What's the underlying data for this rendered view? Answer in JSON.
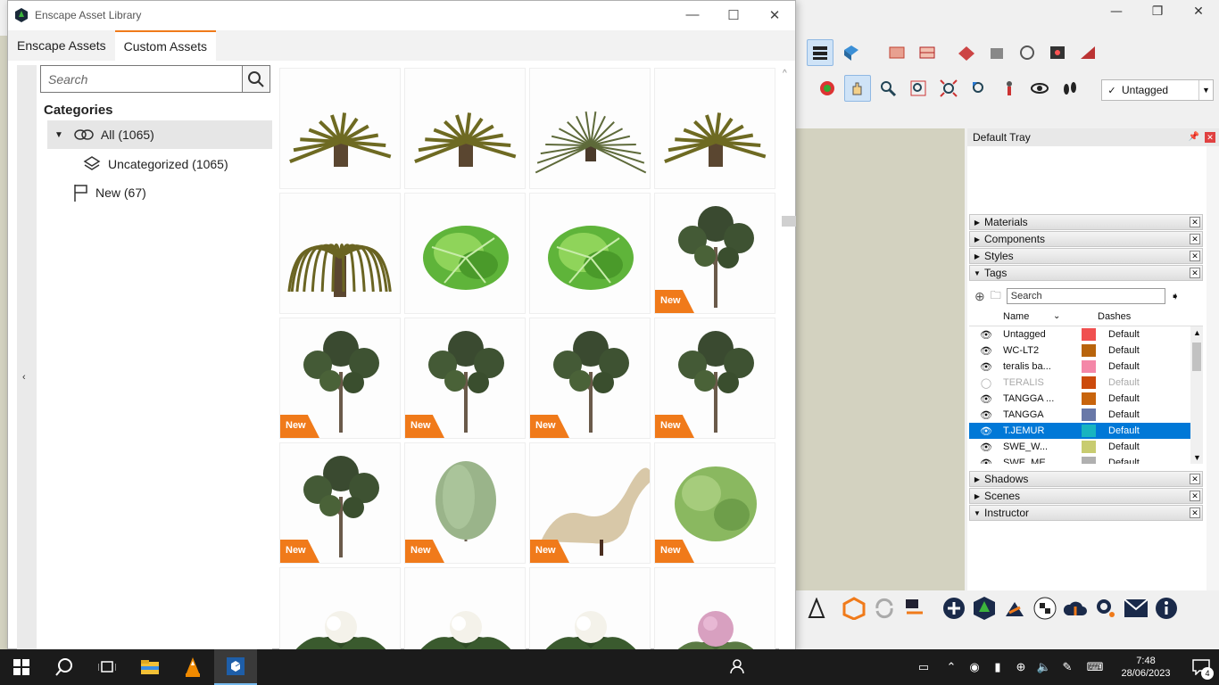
{
  "enscape": {
    "title": "Enscape Asset Library",
    "tabs": [
      "Enscape Assets",
      "Custom Assets"
    ],
    "active_tab": "Custom Assets",
    "search_placeholder": "Search",
    "categories_heading": "Categories",
    "categories": [
      {
        "label": "All (1065)",
        "icon": "all-assets-icon",
        "selected": true
      },
      {
        "label": "Uncategorized (1065)",
        "icon": "layers-icon"
      },
      {
        "label": "New (67)",
        "icon": "flag-icon"
      }
    ],
    "new_badge": "New",
    "assets": [
      {
        "kind": "palm-dry",
        "new": false
      },
      {
        "kind": "palm-dry",
        "new": false
      },
      {
        "kind": "palm-grass",
        "new": false
      },
      {
        "kind": "palm-dry",
        "new": false
      },
      {
        "kind": "palm-droop",
        "new": false
      },
      {
        "kind": "leafy-plant",
        "new": false
      },
      {
        "kind": "leafy-plant",
        "new": false
      },
      {
        "kind": "tree",
        "new": true
      },
      {
        "kind": "tree",
        "new": true
      },
      {
        "kind": "tree",
        "new": true
      },
      {
        "kind": "tree",
        "new": true
      },
      {
        "kind": "tree",
        "new": true
      },
      {
        "kind": "tree",
        "new": true
      },
      {
        "kind": "willow",
        "new": true
      },
      {
        "kind": "chaise-lounge",
        "new": true
      },
      {
        "kind": "shrub",
        "new": true
      },
      {
        "kind": "cauliflower",
        "new": false
      },
      {
        "kind": "cauliflower",
        "new": false
      },
      {
        "kind": "cauliflower",
        "new": false
      },
      {
        "kind": "cauliflower-pink",
        "new": false
      }
    ]
  },
  "sketchup": {
    "tag_dropdown": "Untagged",
    "tray_title": "Default Tray",
    "panels_top": [
      {
        "label": "Materials",
        "open": false
      },
      {
        "label": "Components",
        "open": false
      },
      {
        "label": "Styles",
        "open": false
      },
      {
        "label": "Tags",
        "open": true
      }
    ],
    "tags_search_placeholder": "Search",
    "tags_columns": {
      "name": "Name",
      "dashes": "Dashes"
    },
    "tags": [
      {
        "name": "Untagged",
        "color": "#f05050",
        "dashes": "Default",
        "visible": true
      },
      {
        "name": "WC-LT2",
        "color": "#b8640c",
        "dashes": "Default",
        "visible": true
      },
      {
        "name": "teralis ba...",
        "color": "#f487a8",
        "dashes": "Default",
        "visible": true
      },
      {
        "name": "TERALIS",
        "color": "#cc4a0c",
        "dashes": "Default",
        "visible": false
      },
      {
        "name": "TANGGA ...",
        "color": "#c8640c",
        "dashes": "Default",
        "visible": true
      },
      {
        "name": "TANGGA",
        "color": "#6878a8",
        "dashes": "Default",
        "visible": true
      },
      {
        "name": "T.JEMUR",
        "color": "#18b4c0",
        "dashes": "Default",
        "visible": true,
        "selected": true
      },
      {
        "name": "SWE_W...",
        "color": "#c8cc70",
        "dashes": "Default",
        "visible": true
      },
      {
        "name": "SWE_ME",
        "color": "#b0b0b0",
        "dashes": "Default",
        "visible": true
      }
    ],
    "panels_bottom": [
      {
        "label": "Shadows",
        "open": false
      },
      {
        "label": "Scenes",
        "open": false
      },
      {
        "label": "Instructor",
        "open": true
      }
    ]
  },
  "taskbar": {
    "time": "7:48",
    "date": "28/06/2023",
    "notification_count": "4"
  }
}
